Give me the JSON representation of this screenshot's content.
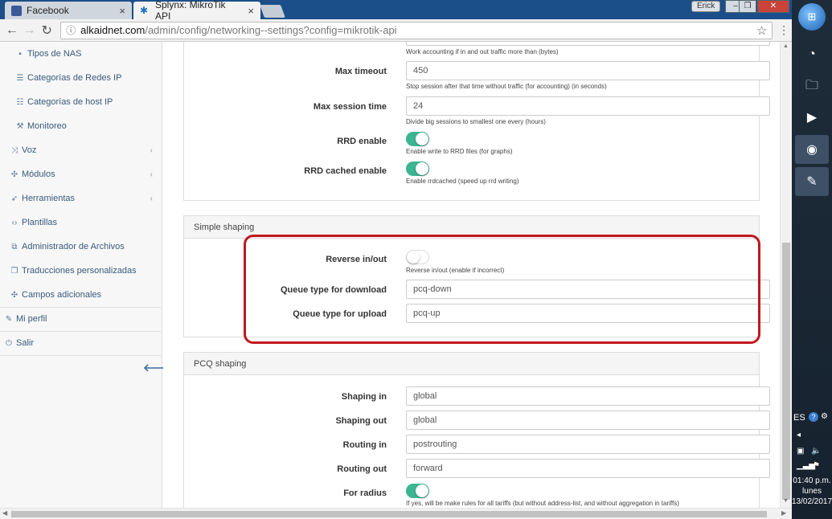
{
  "browser": {
    "tabs": [
      {
        "label": "Facebook",
        "icon": "facebook-icon",
        "color": "#3b5998"
      },
      {
        "label": "Splynx: MikroTik API",
        "icon": "splynx-gear-icon",
        "color": "#1f6fc5"
      }
    ],
    "user": "Erick",
    "url_host": "alkaidnet.com",
    "url_path": "/admin/config/networking--settings?config=mikrotik-api"
  },
  "sidebar": {
    "items": [
      {
        "label": "Tipos de NAS",
        "icon": "server-icon"
      },
      {
        "label": "Categorías de Redes IP",
        "icon": "list-icon"
      },
      {
        "label": "Categorías de host IP",
        "icon": "list-ordered-icon"
      },
      {
        "label": "Monitoreo",
        "icon": "wrench-icon"
      },
      {
        "label": "Voz",
        "icon": "shuffle-icon"
      },
      {
        "label": "Módulos",
        "icon": "puzzle-icon"
      },
      {
        "label": "Herramientas",
        "icon": "rocket-icon"
      },
      {
        "label": "Plantillas",
        "icon": "code-icon"
      },
      {
        "label": "Administrador de Archivos",
        "icon": "files-icon"
      },
      {
        "label": "Traducciones personalizadas",
        "icon": "copy-icon"
      },
      {
        "label": "Campos adicionales",
        "icon": "puzzle-icon"
      },
      {
        "label": "Mi perfil",
        "icon": "pencil-icon"
      },
      {
        "label": "Salir",
        "icon": "logout-icon"
      }
    ]
  },
  "accounting": {
    "top_help": "Work accounting if in and out traffic more than (bytes)",
    "max_timeout_label": "Max timeout",
    "max_timeout_value": "450",
    "max_timeout_help": "Stop session after that time without traffic (for accounting) (in seconds)",
    "max_session_label": "Max session time",
    "max_session_value": "24",
    "max_session_help": "Divide big sessions to smallest one every (hours)",
    "rrd_enable_label": "RRD enable",
    "rrd_enable_on": true,
    "rrd_enable_help": "Enable write to RRD files (for graphs)",
    "rrd_cached_label": "RRD cached enable",
    "rrd_cached_on": true,
    "rrd_cached_help": "Enable rrdcached (speed up rrd writing)"
  },
  "simple_shaping": {
    "title": "Simple shaping",
    "reverse_label": "Reverse in/out",
    "reverse_on": false,
    "reverse_help": "Reverse in/out (enable if incorrect)",
    "download_label": "Queue type for download",
    "download_value": "pcq-down",
    "upload_label": "Queue type for upload",
    "upload_value": "pcq-up"
  },
  "pcq_shaping": {
    "title": "PCQ shaping",
    "shaping_in_label": "Shaping in",
    "shaping_in_value": "global",
    "shaping_out_label": "Shaping out",
    "shaping_out_value": "global",
    "routing_in_label": "Routing in",
    "routing_in_value": "postrouting",
    "routing_out_label": "Routing out",
    "routing_out_value": "forward",
    "for_radius_label": "For radius",
    "for_radius_on": true,
    "for_radius_help": "If yes, will be make rules for all tariffs (but without address-list, and without aggregation in tariffs)"
  },
  "taskbar": {
    "lang": "ES",
    "time": "01:40 p.m.",
    "day": "lunes",
    "date": "13/02/2017"
  },
  "colors": {
    "toggle_on": "#3bb592",
    "highlight": "#c0181f",
    "link": "#3a5a7a"
  }
}
